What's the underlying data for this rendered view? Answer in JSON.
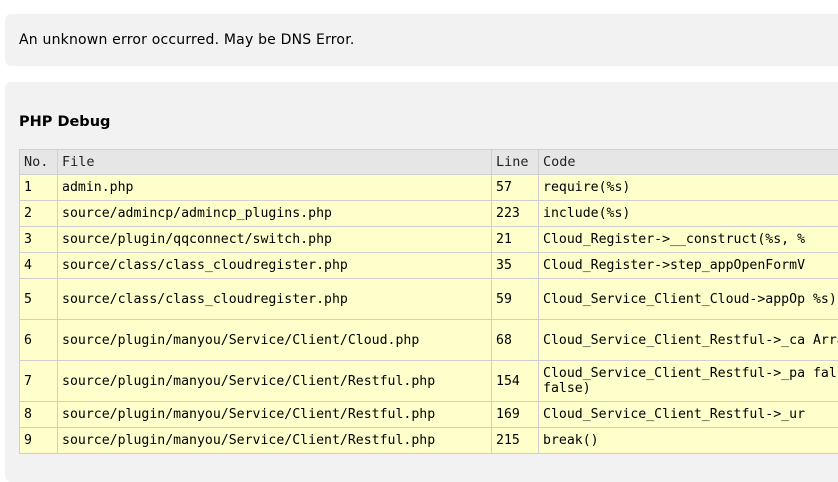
{
  "error": {
    "message": "An unknown error occurred. May be DNS Error."
  },
  "debug": {
    "title": "PHP Debug",
    "columns": {
      "no": "No.",
      "file": "File",
      "line": "Line",
      "code": "Code"
    },
    "rows": [
      {
        "no": "1",
        "file": "admin.php",
        "line": "57",
        "code": "require(%s)"
      },
      {
        "no": "2",
        "file": "source/admincp/admincp_plugins.php",
        "line": "223",
        "code": "include(%s)"
      },
      {
        "no": "3",
        "file": "source/plugin/qqconnect/switch.php",
        "line": "21",
        "code": "Cloud_Register->__construct(%s, %"
      },
      {
        "no": "4",
        "file": "source/class/class_cloudregister.php",
        "line": "35",
        "code": "Cloud_Register->step_appOpenFormV"
      },
      {
        "no": "5",
        "file": "source/class/class_cloudregister.php",
        "line": "59",
        "code": "Cloud_Service_Client_Cloud->appOp %s)"
      },
      {
        "no": "6",
        "file": "source/plugin/manyou/Service/Client/Cloud.php",
        "line": "68",
        "code": "Cloud_Service_Client_Restful->_ca Array)"
      },
      {
        "no": "7",
        "file": "source/plugin/manyou/Service/Client/Restful.php",
        "line": "154",
        "code": "Cloud_Service_Client_Restful->_pa false, false)"
      },
      {
        "no": "8",
        "file": "source/plugin/manyou/Service/Client/Restful.php",
        "line": "169",
        "code": "Cloud_Service_Client_Restful->_ur"
      },
      {
        "no": "9",
        "file": "source/plugin/manyou/Service/Client/Restful.php",
        "line": "215",
        "code": "break()"
      }
    ]
  }
}
